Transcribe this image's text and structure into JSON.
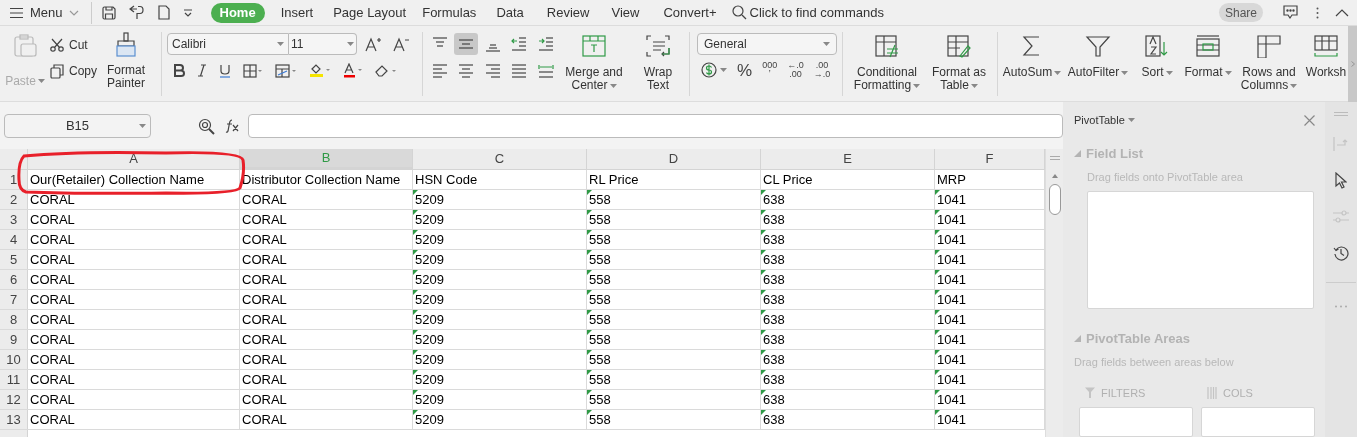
{
  "menu_bar": {
    "menu": "Menu",
    "tabs": [
      {
        "label": "Home",
        "selected": true
      },
      {
        "label": "Insert",
        "selected": false
      },
      {
        "label": "Page Layout",
        "selected": false
      },
      {
        "label": "Formulas",
        "selected": false
      },
      {
        "label": "Data",
        "selected": false
      },
      {
        "label": "Review",
        "selected": false
      },
      {
        "label": "View",
        "selected": false
      },
      {
        "label": "Convert+",
        "selected": false
      }
    ],
    "search": {
      "placeholder": "Click to find commands"
    },
    "share": "Share"
  },
  "ribbon": {
    "clipboard": {
      "paste": {
        "label": "Paste",
        "disabled": true
      },
      "cut": "Cut",
      "copy": "Copy",
      "format_painter": [
        "Format",
        "Painter"
      ]
    },
    "font": {
      "name": "Calibri",
      "size": "11"
    },
    "number": {
      "format": "General",
      "buttons": [
        {
          "kind": "text",
          "text": "%"
        },
        {
          "kind": "stack",
          "lines": [
            "000",
            "ʼ"
          ]
        },
        {
          "kind": "stack",
          "lines": [
            "←.0",
            ".00"
          ]
        },
        {
          "kind": "stack",
          "lines": [
            ".00",
            "→.0"
          ]
        }
      ]
    },
    "button_groups": [
      [
        {
          "kind": "merge",
          "lines": [
            "Merge and",
            "Center"
          ],
          "dropdown": true
        },
        {
          "kind": "wrap",
          "lines": [
            "Wrap",
            "Text"
          ],
          "dropdown": false
        }
      ],
      [
        {
          "kind": "conditional",
          "lines": [
            "Conditional",
            "Formatting"
          ],
          "dropdown": true
        },
        {
          "kind": "table",
          "lines": [
            "Format as",
            "Table"
          ],
          "dropdown": true
        }
      ],
      [
        {
          "kind": "sum",
          "lines": [
            "AutoSum"
          ],
          "dropdown": true
        },
        {
          "kind": "filter",
          "lines": [
            "AutoFilter"
          ],
          "dropdown": true
        },
        {
          "kind": "sort",
          "lines": [
            "Sort"
          ],
          "dropdown": true
        },
        {
          "kind": "format",
          "lines": [
            "Format"
          ],
          "dropdown": true
        },
        {
          "kind": "rowscols",
          "lines": [
            "Rows and",
            "Columns"
          ],
          "dropdown": true
        },
        {
          "kind": "worksheet",
          "lines": [
            "Worksh"
          ],
          "dropdown": false
        }
      ]
    ]
  },
  "formula_bar": {
    "name_box": "B15"
  },
  "sheet": {
    "columns": [
      {
        "label": "A",
        "selected": false,
        "flagged": false
      },
      {
        "label": "B",
        "selected": true,
        "flagged": false
      },
      {
        "label": "C",
        "selected": false,
        "flagged": true
      },
      {
        "label": "D",
        "selected": false,
        "flagged": true
      },
      {
        "label": "E",
        "selected": false,
        "flagged": true
      },
      {
        "label": "F",
        "selected": false,
        "flagged": true
      }
    ],
    "header_row": {
      "number": "1",
      "cells": [
        "Our(Retailer) Collection Name",
        "Distributor Collection Name",
        "HSN Code",
        "RL Price",
        "CL Price",
        "MRP"
      ]
    },
    "rows": [
      {
        "number": "2",
        "cells": [
          "CORAL",
          "CORAL",
          "5209",
          "558",
          "638",
          "1041"
        ]
      },
      {
        "number": "3",
        "cells": [
          "CORAL",
          "CORAL",
          "5209",
          "558",
          "638",
          "1041"
        ]
      },
      {
        "number": "4",
        "cells": [
          "CORAL",
          "CORAL",
          "5209",
          "558",
          "638",
          "1041"
        ]
      },
      {
        "number": "5",
        "cells": [
          "CORAL",
          "CORAL",
          "5209",
          "558",
          "638",
          "1041"
        ]
      },
      {
        "number": "6",
        "cells": [
          "CORAL",
          "CORAL",
          "5209",
          "558",
          "638",
          "1041"
        ]
      },
      {
        "number": "7",
        "cells": [
          "CORAL",
          "CORAL",
          "5209",
          "558",
          "638",
          "1041"
        ]
      },
      {
        "number": "8",
        "cells": [
          "CORAL",
          "CORAL",
          "5209",
          "558",
          "638",
          "1041"
        ]
      },
      {
        "number": "9",
        "cells": [
          "CORAL",
          "CORAL",
          "5209",
          "558",
          "638",
          "1041"
        ]
      },
      {
        "number": "10",
        "cells": [
          "CORAL",
          "CORAL",
          "5209",
          "558",
          "638",
          "1041"
        ]
      },
      {
        "number": "11",
        "cells": [
          "CORAL",
          "CORAL",
          "5209",
          "558",
          "638",
          "1041"
        ]
      },
      {
        "number": "12",
        "cells": [
          "CORAL",
          "CORAL",
          "5209",
          "558",
          "638",
          "1041"
        ]
      },
      {
        "number": "13",
        "cells": [
          "CORAL",
          "CORAL",
          "5209",
          "558",
          "638",
          "1041"
        ]
      }
    ]
  },
  "pivot_panel": {
    "title": "PivotTable",
    "field_list": "Field List",
    "field_hint": "Drag fields onto PivotTable area",
    "areas": "PivotTable Areas",
    "areas_hint": "Drag fields between areas below",
    "area_labels": [
      "FILTERS",
      "COLS"
    ]
  }
}
